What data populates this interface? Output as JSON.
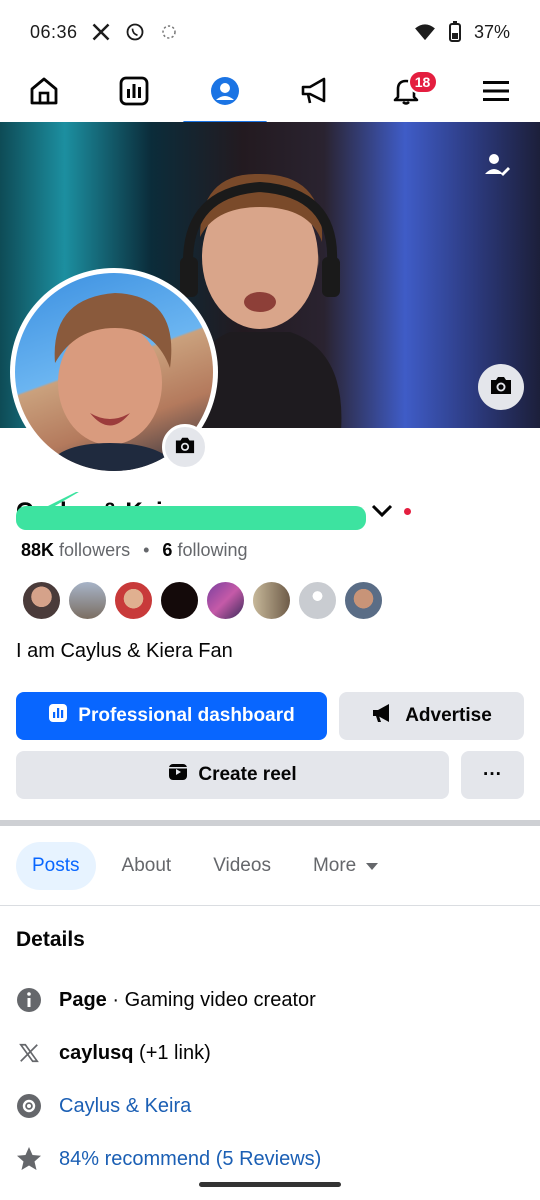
{
  "status": {
    "time": "06:36",
    "battery": "37%"
  },
  "nav": {
    "tabs": [
      {
        "name": "home",
        "icon": "home-icon"
      },
      {
        "name": "dashboard",
        "icon": "bar-chart-icon"
      },
      {
        "name": "profile",
        "icon": "profile-icon",
        "active": true
      },
      {
        "name": "ads",
        "icon": "megaphone-icon"
      },
      {
        "name": "notifications",
        "icon": "bell-icon",
        "badge": "18"
      },
      {
        "name": "menu",
        "icon": "hamburger-icon"
      }
    ]
  },
  "profile": {
    "name": "Caylus & Keira",
    "followers_count": "88K",
    "followers_label": "followers",
    "following_count": "6",
    "following_label": "following",
    "bio": "I am Caylus & Kiera Fan"
  },
  "buttons": {
    "dashboard": "Professional dashboard",
    "advertise": "Advertise",
    "create_reel": "Create reel",
    "more": "···"
  },
  "tabs": {
    "posts": "Posts",
    "about": "About",
    "videos": "Videos",
    "more": "More"
  },
  "details": {
    "title": "Details",
    "page_bold": "Page",
    "page_rest": " · Gaming video creator",
    "x_handle": "caylusq",
    "x_rest": " (+1 link)",
    "link_name": "Caylus & Keira",
    "reviews": "84% recommend (5 Reviews)"
  },
  "colors": {
    "primary": "#0866ff",
    "badge": "#e41e3f",
    "redaction": "#3de3a0"
  }
}
